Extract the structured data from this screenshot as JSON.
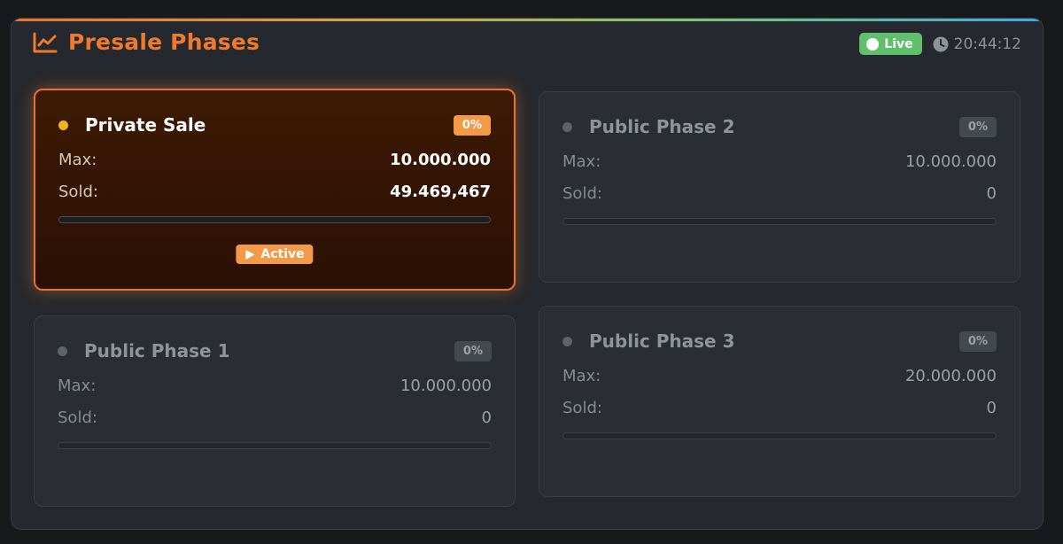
{
  "header": {
    "title": "Presale Phases",
    "icon": "trending-chart-icon",
    "live_label": "Live",
    "time": "20:44:12"
  },
  "colors": {
    "accent": "#ef7a2c",
    "live": "#5fbf6c",
    "active_dot": "#f0b320"
  },
  "phases": [
    {
      "name": "Private Sale",
      "percent": "0%",
      "max_label": "Max:",
      "max": "10.000.000",
      "sold_label": "Sold:",
      "sold": "49.469,467",
      "progress": 0,
      "status": "Active"
    },
    {
      "name": "Public Phase 2",
      "percent": "0%",
      "max_label": "Max:",
      "max": "10.000.000",
      "sold_label": "Sold:",
      "sold": "0",
      "progress": 0
    },
    {
      "name": "Public Phase 1",
      "percent": "0%",
      "max_label": "Max:",
      "max": "10.000.000",
      "sold_label": "Sold:",
      "sold": "0",
      "progress": 0
    },
    {
      "name": "Public Phase 3",
      "percent": "0%",
      "max_label": "Max:",
      "max": "20.000.000",
      "sold_label": "Sold:",
      "sold": "0",
      "progress": 0
    }
  ]
}
